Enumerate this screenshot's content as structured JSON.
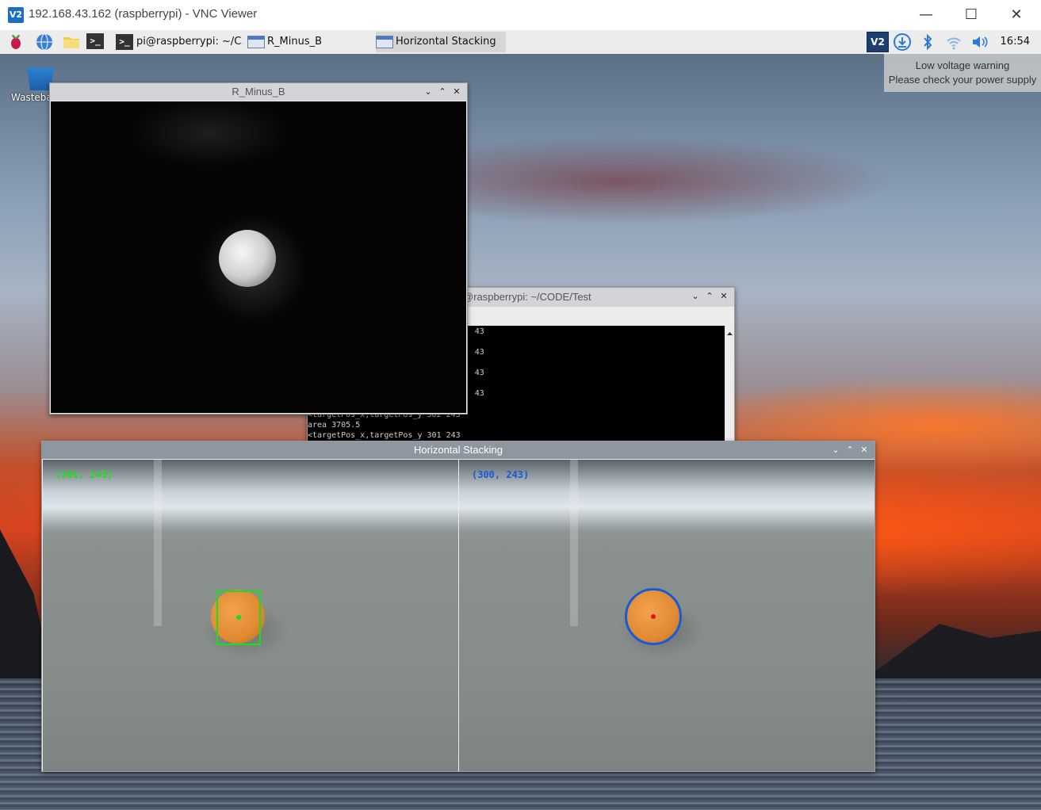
{
  "vnc": {
    "logo": "V2",
    "title": "192.168.43.162 (raspberrypi) - VNC Viewer",
    "minimize": "—",
    "maximize": "☐",
    "close": "✕"
  },
  "taskbar": {
    "tasks": [
      {
        "label": "pi@raspberrypi: ~/C..."
      },
      {
        "label": "R_Minus_B"
      },
      {
        "label": "Horizontal Stacking"
      }
    ],
    "term_glyph": ">_",
    "clock": "16:54"
  },
  "desktop": {
    "wastebasket_label": "Wasteba",
    "low_voltage": {
      "line1": "Low voltage warning",
      "line2": "Please check your power supply"
    }
  },
  "windows": {
    "r_minus_b": {
      "title": "R_Minus_B"
    },
    "terminal": {
      "title": "@raspberrypi: ~/CODE/Test",
      "lines": [
        "                                   43",
        "                                   43",
        "                                   43",
        "                                   43",
        "<targetPos_x,targetPos_y 302 243",
        "area 3705.5",
        "<targetPos_x,targetPos_y 301 243"
      ]
    },
    "horizontal_stacking": {
      "title": "Horizontal Stacking",
      "left_coord": "(301, 243)",
      "right_coord": "(300, 243)"
    },
    "buttons": {
      "min": "⌄",
      "max": "⌃",
      "close": "✕"
    }
  },
  "colors": {
    "bbox_green": "#18e018",
    "circle_blue": "#1a5ad8",
    "ball_orange": "#e08a32"
  }
}
